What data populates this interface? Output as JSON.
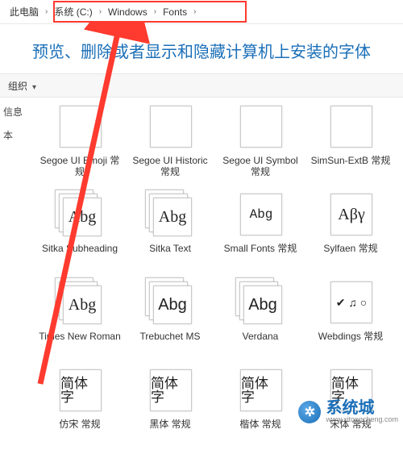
{
  "breadcrumb": [
    "此电脑",
    "系统 (C:)",
    "Windows",
    "Fonts"
  ],
  "page_title": "预览、删除或者显示和隐藏计算机上安装的字体",
  "toolbar": {
    "organize": "组织"
  },
  "sidebar": {
    "item1": "信息",
    "item2": "本"
  },
  "fonts": [
    {
      "label": "Segoe UI Emoji 常规",
      "sample": "",
      "variant": "single"
    },
    {
      "label": "Segoe UI Historic 常规",
      "sample": "",
      "variant": "single"
    },
    {
      "label": "Segoe UI Symbol 常规",
      "sample": "",
      "variant": "single"
    },
    {
      "label": "SimSun-ExtB 常规",
      "sample": "",
      "variant": "single"
    },
    {
      "label": "Sitka Subheading",
      "sample": "Abg",
      "variant": "stack",
      "style": "font-family:Georgia,serif"
    },
    {
      "label": "Sitka Text",
      "sample": "Abg",
      "variant": "stack",
      "style": "font-family:Georgia,serif"
    },
    {
      "label": "Small Fonts 常规",
      "sample": "Abg",
      "variant": "single",
      "style": "font-family:monospace;font-size:16px"
    },
    {
      "label": "Sylfaen 常规",
      "sample": "Aβγ",
      "variant": "single",
      "style": "font-family:Georgia,serif"
    },
    {
      "label": "Times New Roman",
      "sample": "Abg",
      "variant": "stack",
      "style": "font-family:'Times New Roman',serif"
    },
    {
      "label": "Trebuchet MS",
      "sample": "Abg",
      "variant": "stack",
      "style": "font-family:'Trebuchet MS',sans-serif"
    },
    {
      "label": "Verdana",
      "sample": "Abg",
      "variant": "stack",
      "style": "font-family:Verdana,sans-serif"
    },
    {
      "label": "Webdings 常规",
      "sample": "✔ ♫ ○",
      "variant": "single",
      "style": "font-size:14px"
    },
    {
      "label": "仿宋 常规",
      "sample": "简体字",
      "variant": "single",
      "style": "font-family:FangSong,serif;font-size:17px"
    },
    {
      "label": "黑体 常规",
      "sample": "简体字",
      "variant": "single",
      "style": "font-family:SimHei,sans-serif;font-size:17px"
    },
    {
      "label": "楷体 常规",
      "sample": "简体字",
      "variant": "single",
      "style": "font-family:KaiTi,serif;font-size:17px"
    },
    {
      "label": "宋体 常规",
      "sample": "简体字",
      "variant": "single",
      "style": "font-family:SimSun,serif;font-size:17px"
    }
  ],
  "watermark": {
    "text": "系统城",
    "url": "www.xitongcheng.com",
    "icon": "✲"
  },
  "colors": {
    "accent": "#1b6fb8",
    "highlight": "#ff3a2f"
  }
}
